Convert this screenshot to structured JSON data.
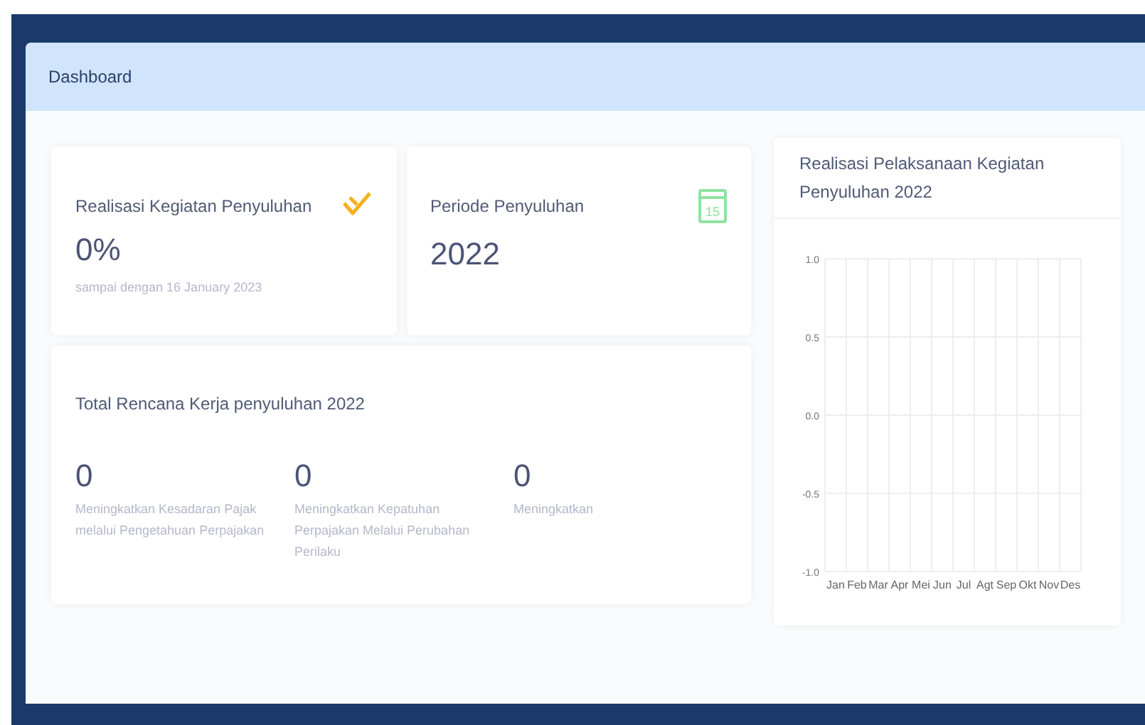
{
  "header": {
    "title": "Dashboard"
  },
  "stat_cards": [
    {
      "kind": "check",
      "label": "Realisasi Kegiatan Penyuluhan",
      "value": "0%",
      "note": "sampai dengan 16 January 2023"
    },
    {
      "kind": "calendar",
      "label": "Periode Penyuluhan",
      "value": "2022",
      "icon_text": "15"
    }
  ],
  "plan_card": {
    "title": "Total Rencana Kerja penyuluhan 2022",
    "items": [
      {
        "value": "0",
        "label": "Meningkatkan Kesadaran Pajak melalui Pengetahuan Perpajakan"
      },
      {
        "value": "0",
        "label": "Meningkatkan Kepatuhan Perpajakan Melalui Perubahan Perilaku"
      },
      {
        "value": "0",
        "label": "Meningkatkan"
      }
    ]
  },
  "chart_card": {
    "title": "Realisasi Pelaksanaan Kegiatan Penyuluhan 2022",
    "chart_data": {
      "type": "line",
      "grid": true,
      "categories": [
        "Jan",
        "Feb",
        "Mar",
        "Apr",
        "Mei",
        "Jun",
        "Jul",
        "Agt",
        "Sep",
        "Okt",
        "Nov",
        "Des"
      ],
      "ylim": [
        -1,
        1
      ],
      "yticks": [
        {
          "value": -1,
          "label": "-1.0"
        },
        {
          "value": -0.5,
          "label": "-0.5"
        },
        {
          "value": 0,
          "label": "0.0"
        },
        {
          "value": 0.5,
          "label": "0.5"
        },
        {
          "value": 1,
          "label": "1.0"
        }
      ]
    }
  }
}
